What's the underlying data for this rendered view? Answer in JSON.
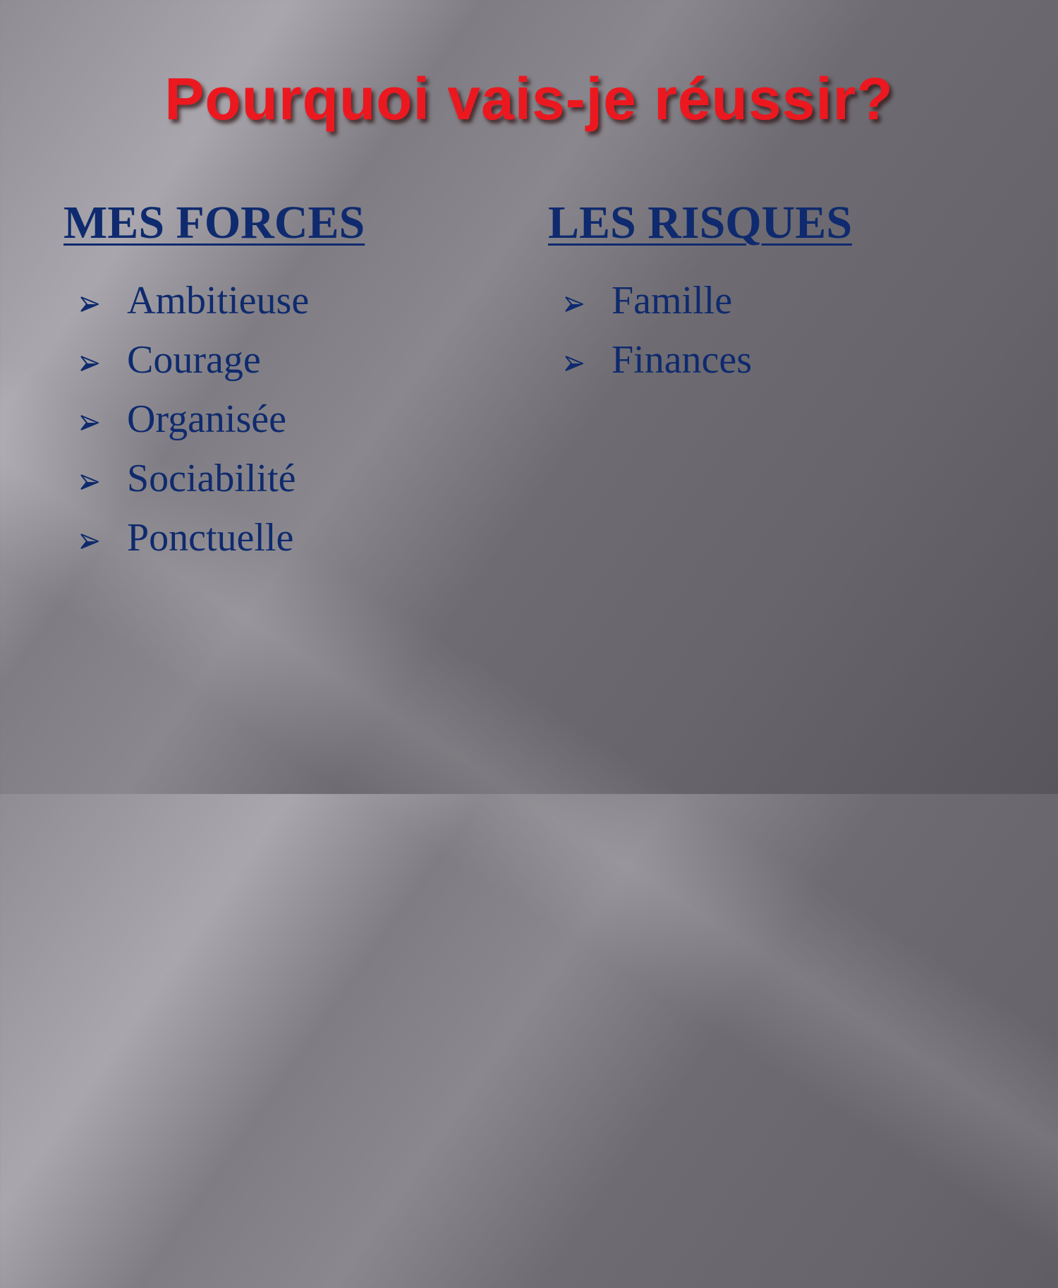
{
  "slide": {
    "title": "Pourquoi vais-je réussir?",
    "left": {
      "heading": "MES FORCES",
      "items": [
        "Ambitieuse",
        "Courage",
        "Organisée",
        "Sociabilité",
        "Ponctuelle"
      ]
    },
    "right": {
      "heading": "LES RISQUES",
      "items": [
        "Famille",
        "Finances"
      ]
    }
  },
  "colors": {
    "title": "#ec1820",
    "text": "#0f2a6e"
  },
  "bullet_icon": "arrowhead-bullet-icon"
}
